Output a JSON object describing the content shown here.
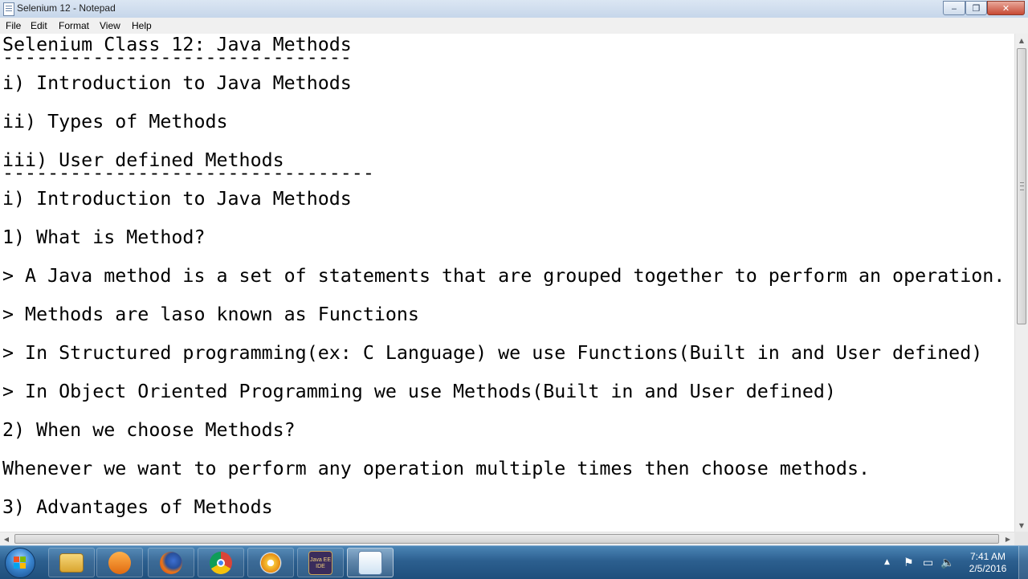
{
  "window": {
    "title": "Selenium 12 - Notepad",
    "minimize_glyph": "‒",
    "maximize_glyph": "❐",
    "close_glyph": "✕"
  },
  "menu": [
    "File",
    "Edit",
    "Format",
    "View",
    "Help"
  ],
  "editor": {
    "lines": [
      "Selenium Class 12: Java Methods",
      "-------------------------------",
      "i) Introduction to Java Methods",
      "ii) Types of Methods",
      "iii) User defined Methods",
      "---------------------------------",
      "i) Introduction to Java Methods",
      "1) What is Method?",
      "> A Java method is a set of statements that are grouped together to perform an operation.",
      "> Methods are laso known as Functions",
      "> In Structured programming(ex: C Language) we use Functions(Built in and User defined)",
      "> In Object Oriented Programming we use Methods(Built in and User defined)",
      "2) When we choose Methods?",
      "Whenever we want to perform any operation multiple times then choose methods.",
      "3) Advantages of Methods"
    ]
  },
  "scrollbars": {
    "up_arrow": "▲",
    "down_arrow": "▼",
    "left_arrow": "◀",
    "right_arrow": "▶"
  },
  "taskbar": {
    "pinned": [
      {
        "name": "explorer-icon"
      },
      {
        "name": "media-player-icon"
      },
      {
        "name": "firefox-icon"
      },
      {
        "name": "chrome-icon"
      },
      {
        "name": "flower-app-icon"
      },
      {
        "name": "java-ee-ide-icon",
        "label": "Java EE IDE"
      },
      {
        "name": "notepad-icon",
        "active": true
      }
    ],
    "tray": {
      "show_hidden": "▲",
      "flag": "⚑",
      "network": "▭",
      "volume": "🔈"
    },
    "clock": {
      "time": "7:41 AM",
      "date": "2/5/2016"
    }
  },
  "colors": {
    "taskbar": "#2c5f8f",
    "close_button": "#c74a35"
  }
}
